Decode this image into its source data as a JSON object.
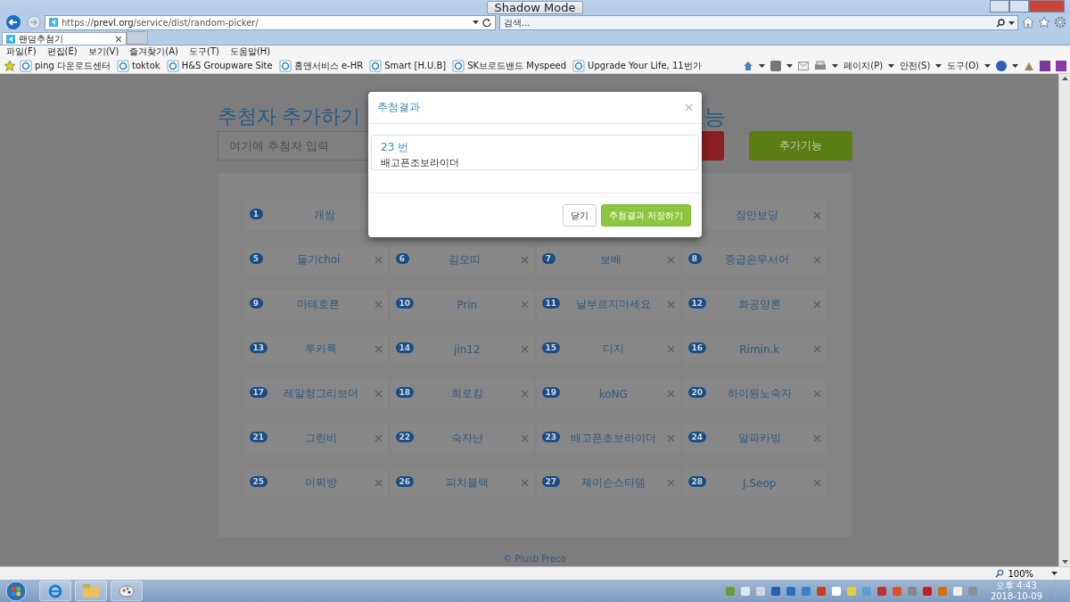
{
  "browser": {
    "shadow_mode_button": "Shadow Mode",
    "address": "https://**prevl.org**/service/dist/random-picker/",
    "search_placeholder": "검색...",
    "tabs": [
      {
        "label": "랜덤추첨기",
        "selected": true
      }
    ],
    "menu": [
      "파일(F)",
      "편집(E)",
      "보기(V)",
      "즐겨찾기(A)",
      "도구(T)",
      "도움말(H)"
    ],
    "favorites": [
      "ping 다운로드센터",
      "toktok",
      "H&S Groupware Site",
      "홈앤서비스 e-HR",
      "Smart [H.U.B]",
      "SK브로드밴드 Myspeed",
      "Upgrade Your Life, 11번가"
    ],
    "commands": [
      "페이지(P)",
      "안전(S)",
      "도구(O)"
    ]
  },
  "page": {
    "heading": "추첨자 추가하기",
    "heading_right": "능",
    "input_placeholder": "여기에 추첨자 입력",
    "extra_button": "추가기능",
    "grid": [
      [
        {
          "number": "1",
          "name": "개쌈"
        },
        {
          "name": "잠만보딩"
        }
      ],
      [
        {
          "number": "5",
          "name": "둘기choi"
        },
        {
          "number": "6",
          "name": "김오띠"
        },
        {
          "number": "7",
          "name": "보베"
        },
        {
          "number": "8",
          "name": "중급은무서어"
        }
      ],
      [
        {
          "number": "9",
          "name": "마테호른"
        },
        {
          "number": "10",
          "name": "Prin"
        },
        {
          "number": "11",
          "name": "날부르지마세요"
        },
        {
          "number": "12",
          "name": "화공양론"
        }
      ],
      [
        {
          "number": "13",
          "name": "루키룩"
        },
        {
          "number": "14",
          "name": "jin12"
        },
        {
          "number": "15",
          "name": "디지"
        },
        {
          "number": "16",
          "name": "Rimin.k"
        }
      ],
      [
        {
          "number": "17",
          "name": "레알헝그리보더"
        },
        {
          "number": "18",
          "name": "희로킴"
        },
        {
          "number": "19",
          "name": "koNG"
        },
        {
          "number": "20",
          "name": "하이원노숙자"
        }
      ],
      [
        {
          "number": "21",
          "name": "그린비"
        },
        {
          "number": "22",
          "name": "숙자냔"
        },
        {
          "number": "23",
          "name": "배고픈초보라이더"
        },
        {
          "number": "24",
          "name": "알파카빙"
        }
      ],
      [
        {
          "number": "25",
          "name": "이찌방"
        },
        {
          "number": "26",
          "name": "피치블랙"
        },
        {
          "number": "27",
          "name": "제이슨스타뎀"
        },
        {
          "number": "28",
          "name": "J.Seop"
        }
      ]
    ],
    "footer": "© Plusb Preco"
  },
  "modal": {
    "title": "추첨결과",
    "result_number": "23 번",
    "result_name": "배고픈조보라이더",
    "buttons": [
      {
        "label": "닫기",
        "kind": "default"
      },
      {
        "label": "추첨결과 저장하기",
        "kind": "primary"
      }
    ]
  },
  "status_bar": {
    "zoom": "100%"
  },
  "taskbar": {
    "time": "오후 4:43",
    "date": "2018-10-09"
  }
}
